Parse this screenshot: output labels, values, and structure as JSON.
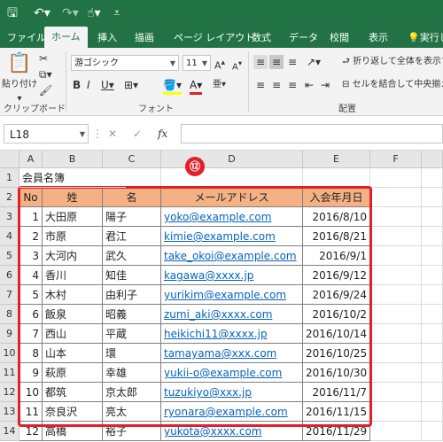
{
  "ribbon_tabs": [
    "ファイル",
    "ホーム",
    "挿入",
    "描画",
    "ページ レイアウト",
    "数式",
    "データ",
    "校閲",
    "表示",
    "実行し"
  ],
  "ribbon": {
    "paste_label": "貼り付け",
    "clipboard_label": "クリップボード",
    "font_name": "游ゴシック",
    "font_size": "11",
    "font_label": "フォント",
    "wrap_text": "折り返して全体を表示す",
    "merge_center": "セルを結合して中央揃え",
    "alignment_label": "配置"
  },
  "formula_bar": {
    "name_box": "L18",
    "fx": "fx",
    "cancel": "✕",
    "enter": "✓",
    "formula": ""
  },
  "columns": [
    "A",
    "B",
    "C",
    "D",
    "E",
    "F"
  ],
  "rows": [
    "1",
    "2",
    "3",
    "4",
    "5",
    "6",
    "7",
    "8",
    "9",
    "10",
    "11",
    "12",
    "13",
    "14"
  ],
  "sheet": {
    "title": "会員名簿",
    "headers": [
      "No",
      "姓",
      "名",
      "メールアドレス",
      "入会年月日"
    ],
    "records": [
      [
        "1",
        "大田原",
        "陽子",
        "yoko@example.com",
        "2016/8/10"
      ],
      [
        "2",
        "市原",
        "君江",
        "kimie@example.com",
        "2016/8/21"
      ],
      [
        "3",
        "大河内",
        "武久",
        "take_okoi@example.com",
        "2016/9/1"
      ],
      [
        "4",
        "香川",
        "知佳",
        "kagawa@xxxx.jp",
        "2016/9/12"
      ],
      [
        "5",
        "木村",
        "由利子",
        "yurikim@example.com",
        "2016/9/24"
      ],
      [
        "6",
        "飯泉",
        "昭義",
        "zumi_aki@xxxx.com",
        "2016/10/2"
      ],
      [
        "7",
        "西山",
        "平蔵",
        "heikichi11@xxxx.jp",
        "2016/10/14"
      ],
      [
        "8",
        "山本",
        "環",
        "tamayama@xxx.com",
        "2016/10/25"
      ],
      [
        "9",
        "萩原",
        "幸雄",
        "yukii-o@example.com",
        "2016/10/30"
      ],
      [
        "10",
        "都筑",
        "京太郎",
        "tuzukiyo@xxx.jp",
        "2016/11/7"
      ],
      [
        "11",
        "奈良沢",
        "亮太",
        "ryonara@example.com",
        "2016/11/15"
      ],
      [
        "12",
        "高橋",
        "裕子",
        "yukota@xxxx.com",
        "2016/11/29"
      ]
    ]
  },
  "annotation": {
    "step_badge": "⑫"
  },
  "colors": {
    "ribbon_green": "#217346",
    "header_fill": "#f4b183",
    "highlight": "#e0202a",
    "link": "#0563c1"
  }
}
